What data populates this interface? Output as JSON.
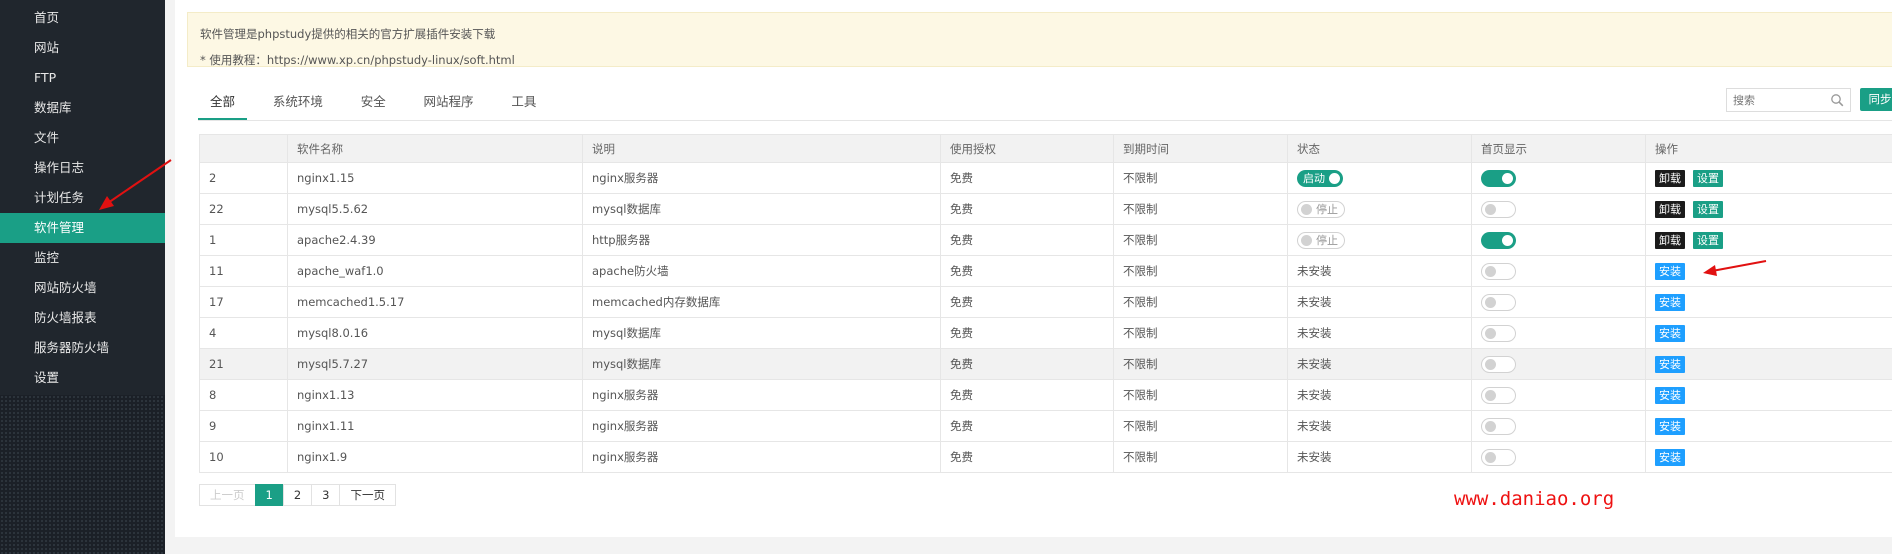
{
  "sidebar": {
    "items": [
      {
        "label": "首页"
      },
      {
        "label": "网站"
      },
      {
        "label": "FTP"
      },
      {
        "label": "数据库"
      },
      {
        "label": "文件"
      },
      {
        "label": "操作日志"
      },
      {
        "label": "计划任务"
      },
      {
        "label": "软件管理",
        "active": true
      },
      {
        "label": "监控"
      },
      {
        "label": "网站防火墙"
      },
      {
        "label": "防火墙报表"
      },
      {
        "label": "服务器防火墙"
      },
      {
        "label": "设置"
      }
    ]
  },
  "notice": {
    "line1": "软件管理是phpstudy提供的相关的官方扩展插件安装下载",
    "line2": "* 使用教程：https://www.xp.cn/phpstudy-linux/soft.html"
  },
  "tabs": [
    {
      "label": "全部",
      "active": true
    },
    {
      "label": "系统环境"
    },
    {
      "label": "安全"
    },
    {
      "label": "网站程序"
    },
    {
      "label": "工具"
    }
  ],
  "toolbar": {
    "search_placeholder": "搜索",
    "sync_label": "同步"
  },
  "table": {
    "columns": [
      "",
      "软件名称",
      "说明",
      "使用授权",
      "到期时间",
      "状态",
      "首页显示",
      "操作"
    ],
    "rows": [
      {
        "id": "2",
        "name": "nginx1.15",
        "desc": "nginx服务器",
        "license": "免费",
        "expire": "不限制",
        "status": "启动",
        "status_type": "on",
        "home": "on",
        "actions": [
          "卸载",
          "设置"
        ]
      },
      {
        "id": "22",
        "name": "mysql5.5.62",
        "desc": "mysql数据库",
        "license": "免费",
        "expire": "不限制",
        "status": "停止",
        "status_type": "off",
        "home": "off",
        "actions": [
          "卸载",
          "设置"
        ]
      },
      {
        "id": "1",
        "name": "apache2.4.39",
        "desc": "http服务器",
        "license": "免费",
        "expire": "不限制",
        "status": "停止",
        "status_type": "off",
        "home": "on",
        "actions": [
          "卸载",
          "设置"
        ]
      },
      {
        "id": "11",
        "name": "apache_waf1.0",
        "desc": "apache防火墙",
        "license": "免费",
        "expire": "不限制",
        "status": "未安装",
        "status_type": "text",
        "home": "off",
        "actions": [
          "安装"
        ]
      },
      {
        "id": "17",
        "name": "memcached1.5.17",
        "desc": "memcached内存数据库",
        "license": "免费",
        "expire": "不限制",
        "status": "未安装",
        "status_type": "text",
        "home": "off",
        "actions": [
          "安装"
        ]
      },
      {
        "id": "4",
        "name": "mysql8.0.16",
        "desc": "mysql数据库",
        "license": "免费",
        "expire": "不限制",
        "status": "未安装",
        "status_type": "text",
        "home": "off",
        "actions": [
          "安装"
        ]
      },
      {
        "id": "21",
        "name": "mysql5.7.27",
        "desc": "mysql数据库",
        "license": "免费",
        "expire": "不限制",
        "status": "未安装",
        "status_type": "text",
        "home": "off",
        "actions": [
          "安装"
        ],
        "highlight": true
      },
      {
        "id": "8",
        "name": "nginx1.13",
        "desc": "nginx服务器",
        "license": "免费",
        "expire": "不限制",
        "status": "未安装",
        "status_type": "text",
        "home": "off",
        "actions": [
          "安装"
        ]
      },
      {
        "id": "9",
        "name": "nginx1.11",
        "desc": "nginx服务器",
        "license": "免费",
        "expire": "不限制",
        "status": "未安装",
        "status_type": "text",
        "home": "off",
        "actions": [
          "安装"
        ]
      },
      {
        "id": "10",
        "name": "nginx1.9",
        "desc": "nginx服务器",
        "license": "免费",
        "expire": "不限制",
        "status": "未安装",
        "status_type": "text",
        "home": "off",
        "actions": [
          "安装"
        ]
      }
    ]
  },
  "pager": {
    "prev": "上一页",
    "pages": [
      "1",
      "2",
      "3"
    ],
    "current": "1",
    "next": "下一页"
  },
  "watermark": "www.daniao.org",
  "colors": {
    "accent": "#1a9f86",
    "install": "#1e9fff",
    "uninstall": "#1b1b1b",
    "annotation": "#e11111"
  }
}
